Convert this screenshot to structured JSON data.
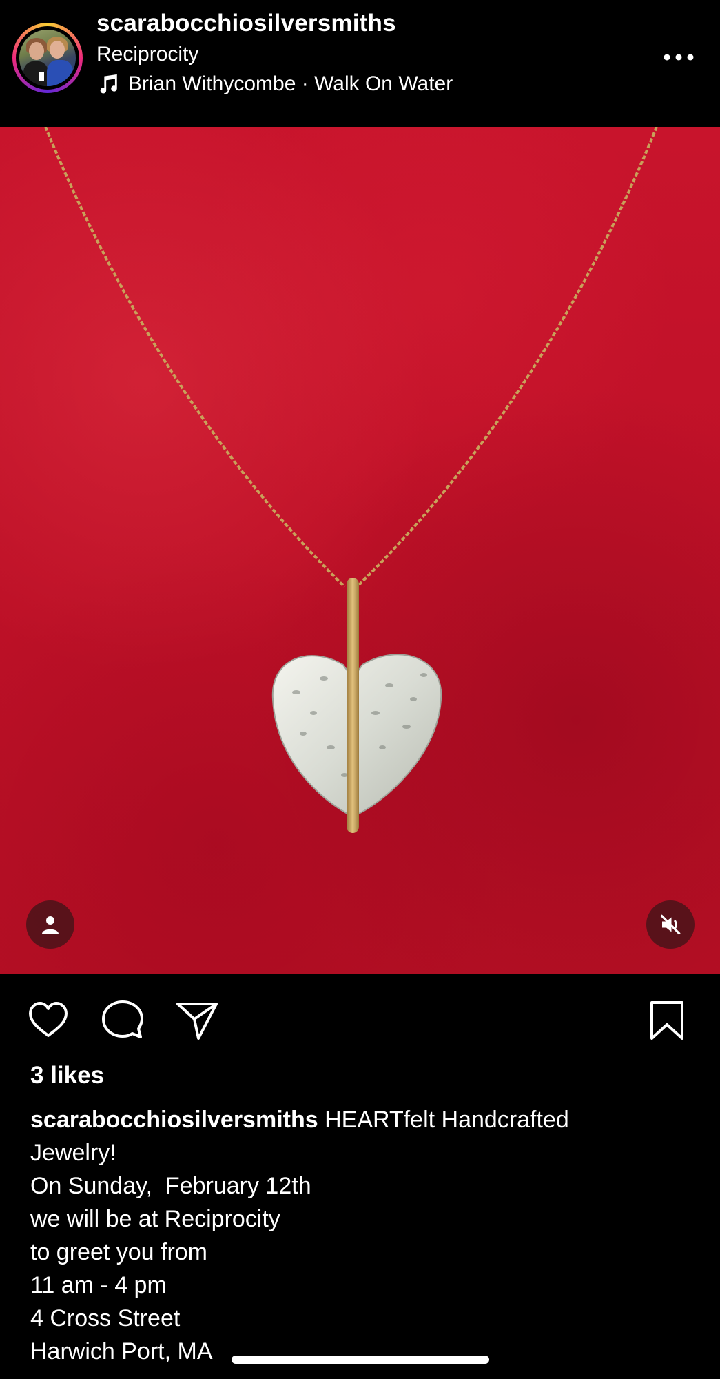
{
  "header": {
    "username": "scarabocchiosilversmiths",
    "location": "Reciprocity",
    "music": "Brian Withycombe · Walk On Water"
  },
  "media": {
    "description_icons": [
      "tag-people-icon",
      "muted-speaker-icon"
    ]
  },
  "post": {
    "likes": "3 likes",
    "caption_user": "scarabocchiosilversmiths",
    "caption_first": "HEARTfelt Handcrafted",
    "caption_lines": [
      "Jewelry!",
      "On Sunday,  February 12th",
      "we will be at Reciprocity",
      "to greet you from",
      "11 am - 4 pm",
      "4 Cross Street",
      "Harwich Port, MA"
    ]
  },
  "colors": {
    "background": "#000000",
    "felt_red": "#c01128",
    "chain_gold": "#c9a15a"
  },
  "icons": {
    "more": "more-horizontal-icon",
    "like": "heart-icon",
    "comment": "comment-bubble-icon",
    "share": "paper-plane-icon",
    "save": "bookmark-icon",
    "music": "music-note-icon"
  }
}
